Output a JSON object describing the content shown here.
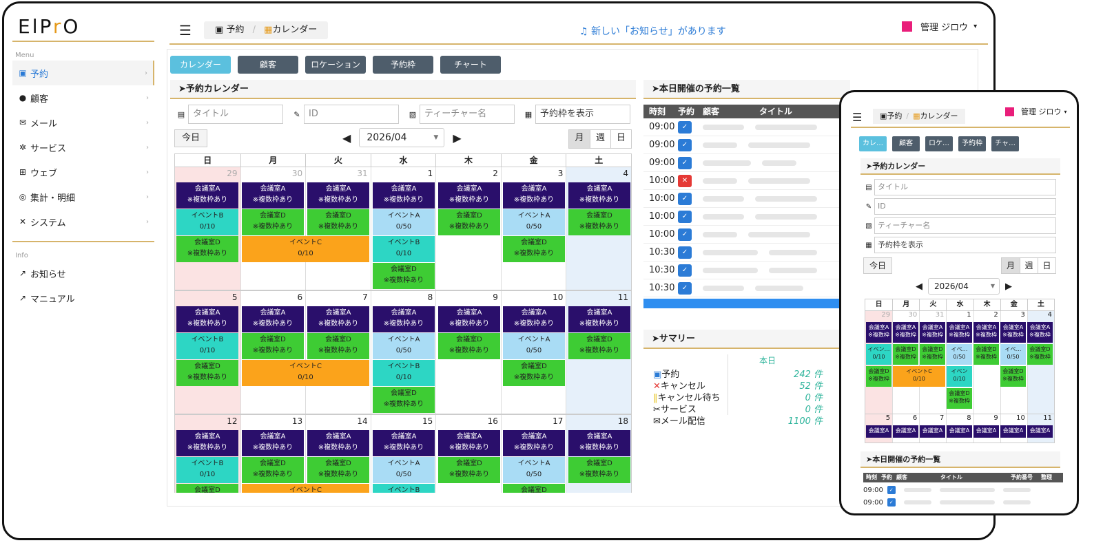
{
  "logo": {
    "pre": "ElP",
    "accent": "r",
    "post": "O"
  },
  "sidebar": {
    "menu_title": "Menu",
    "items": [
      {
        "label": "予約",
        "icon": "calendar-check-icon"
      },
      {
        "label": "顧客",
        "icon": "user-icon"
      },
      {
        "label": "メール",
        "icon": "envelope-icon"
      },
      {
        "label": "サービス",
        "icon": "cogs-icon"
      },
      {
        "label": "ウェブ",
        "icon": "sitemap-icon"
      },
      {
        "label": "集計・明細",
        "icon": "chart-icon"
      },
      {
        "label": "システム",
        "icon": "tools-icon"
      }
    ],
    "info_title": "Info",
    "info_items": [
      {
        "label": "お知らせ",
        "icon": "external-link-icon"
      },
      {
        "label": "マニュアル",
        "icon": "external-link-icon"
      }
    ]
  },
  "header": {
    "crumb1": "予約",
    "crumb_sep": "/",
    "crumb2": "カレンダー",
    "notice": "新しい「お知らせ」があります",
    "user": "管理 ジロウ"
  },
  "tabs": [
    "カレンダー",
    "顧客",
    "ロケーション",
    "予約枠",
    "チャート"
  ],
  "calendar": {
    "title": "予約カレンダー",
    "filter_title": "タイトル",
    "filter_id": "ID",
    "filter_teacher": "ティーチャー名",
    "filter_slot": "予約枠を表示",
    "today": "今日",
    "month": "2026/04",
    "views": [
      "月",
      "週",
      "日"
    ],
    "dow": [
      "日",
      "月",
      "火",
      "水",
      "木",
      "金",
      "土"
    ],
    "weeks": [
      [
        "29",
        "30",
        "31",
        "1",
        "2",
        "3",
        "4"
      ],
      [
        "5",
        "6",
        "7",
        "8",
        "9",
        "10",
        "11"
      ],
      [
        "12",
        "13",
        "14",
        "15",
        "16",
        "17",
        "18"
      ]
    ],
    "ev_room_a": "会議室A",
    "ev_room_d": "会議室D",
    "ev_multi": "※複数枠あり",
    "ev_event_a": "イベントA",
    "ev_event_b": "イベントB",
    "ev_event_c": "イベントC",
    "ev_cap_10": "0/10",
    "ev_cap_50": "0/50"
  },
  "today_list": {
    "title": "本日開催の予約一覧",
    "headers": [
      "時刻",
      "予約",
      "顧客",
      "タイトル"
    ],
    "times": [
      "09:00",
      "09:00",
      "09:00",
      "10:00",
      "10:00",
      "10:00",
      "10:00",
      "10:30",
      "10:30",
      "10:30"
    ]
  },
  "summary": {
    "title": "サマリー",
    "col": "本日",
    "rows": [
      {
        "label": "予約",
        "value": "242 件"
      },
      {
        "label": "キャンセル",
        "value": "52 件"
      },
      {
        "label": "キャンセル待ち",
        "value": "0 件"
      },
      {
        "label": "サービス",
        "value": "0 件"
      },
      {
        "label": "メール配信",
        "value": "1100 件"
      }
    ]
  },
  "phone": {
    "crumb1": "予約",
    "crumb2": "カレンダー",
    "user": "管理 ジロウ",
    "tabs": [
      "カレ…",
      "顧客",
      "ロケ…",
      "予約枠",
      "チャ…"
    ],
    "cal_title": "予約カレンダー",
    "filters": [
      "タイトル",
      "ID",
      "ティーチャー名",
      "予約枠を表示"
    ],
    "today": "今日",
    "views": [
      "月",
      "週",
      "日"
    ],
    "month": "2026/04",
    "room_a": "会議室A",
    "room_d": "会議室D",
    "multi": "※複数枠",
    "ev_a": "イベ…",
    "ev_b": "イベン…",
    "ev_b2": "イベン",
    "ev_c": "イベントC",
    "cap10": "0/10",
    "cap50": "0/50",
    "list_title": "本日開催の予約一覧",
    "list_headers": [
      "時刻",
      "予約",
      "顧客",
      "タイトル",
      "予約番号",
      "整理"
    ],
    "times": [
      "09:00",
      "09:00"
    ]
  },
  "colors": {
    "accent_gold": "#d6b46b",
    "link_blue": "#2b7bd6",
    "room_a": "#2a0f6b",
    "event_b": "#2dd6c4",
    "room_d": "#3ecc34",
    "event_a": "#a9dcf5",
    "event_c": "#fba31b"
  }
}
